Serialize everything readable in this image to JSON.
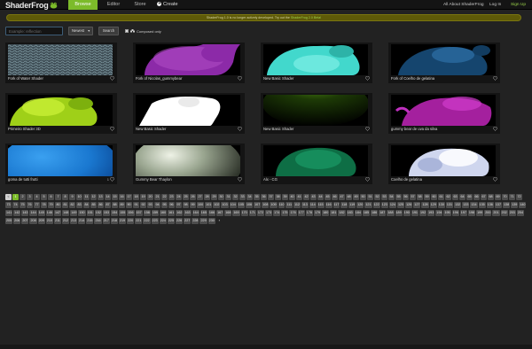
{
  "header": {
    "logo_text": "ShaderFrog",
    "tabs": [
      {
        "label": "Browse",
        "active": true
      },
      {
        "label": "Editor",
        "active": false
      },
      {
        "label": "Store",
        "active": false
      }
    ],
    "create_label": "Create",
    "create_icon": "plus-icon",
    "about_label": "All About ShaderFrog",
    "login_label": "Log In",
    "signup_label": "Sign Up",
    "accent_color": "#7cbb2a"
  },
  "banner": {
    "text": "ShaderFrog 1.0 is no longer actively developed. Try out the ",
    "link_text": "ShaderFrog 2.0 Beta!"
  },
  "search": {
    "placeholder": "Example: reflection",
    "sort_value": "Newest",
    "search_button": "Search",
    "composed_only_label": "Composed only"
  },
  "shaders": [
    {
      "title": "Fork of Water Shader",
      "likes": "",
      "thumb": "water"
    },
    {
      "title": "Fork of Nicolas_gummybear",
      "likes": "",
      "thumb": "purple-bear"
    },
    {
      "title": "New Basic Shader",
      "likes": "",
      "thumb": "cyan-bear"
    },
    {
      "title": "Fork of Coelho de gelatina",
      "likes": "",
      "thumb": "blue-bear"
    },
    {
      "title": "Primeiro Shader 3D",
      "likes": "",
      "thumb": "lime-bear"
    },
    {
      "title": "New Basic Shader",
      "likes": "",
      "thumb": "white-shape"
    },
    {
      "title": "New Basic Shader",
      "likes": "",
      "thumb": "green-sphere"
    },
    {
      "title": "gummy bear de uva da silva",
      "likes": "",
      "thumb": "magenta-bear"
    },
    {
      "title": "goma de tutti frutti",
      "likes": "1",
      "thumb": "blue-sphere"
    },
    {
      "title": "Gummy Bear Thaylon",
      "likes": "",
      "thumb": "grey-sphere"
    },
    {
      "title": "Alx - CG",
      "likes": "",
      "thumb": "teal-bear"
    },
    {
      "title": "Coelho de gelatina",
      "likes": "",
      "thumb": "white-bear"
    }
  ],
  "pagination": {
    "prev_label": "<",
    "current": "1",
    "pages": [
      "1",
      "2",
      "3",
      "4",
      "5",
      "6",
      "7",
      "8",
      "9",
      "10",
      "11",
      "12",
      "13",
      "14",
      "15",
      "16",
      "17",
      "18",
      "19",
      "20",
      "21",
      "22",
      "23",
      "24",
      "25",
      "26",
      "27",
      "28",
      "29",
      "30",
      "31",
      "32",
      "33",
      "34",
      "35",
      "36",
      "37",
      "38",
      "39",
      "40",
      "41",
      "42",
      "43",
      "44",
      "45",
      "46",
      "47",
      "48",
      "49",
      "50",
      "51",
      "52",
      "53",
      "54",
      "55",
      "56",
      "57",
      "58",
      "59",
      "60",
      "61",
      "62",
      "63",
      "64",
      "65",
      "66",
      "67",
      "68",
      "69",
      "70",
      "71",
      "72",
      "73",
      "74",
      "75",
      "76",
      "77",
      "78",
      "79",
      "80",
      "81",
      "82",
      "83",
      "84",
      "85",
      "86",
      "87",
      "88",
      "89",
      "90",
      "91",
      "92",
      "93",
      "94",
      "95",
      "96",
      "97",
      "98",
      "99",
      "100",
      "101",
      "102",
      "103",
      "104",
      "105",
      "106",
      "107",
      "108",
      "109",
      "110",
      "111",
      "112",
      "113",
      "114",
      "115",
      "116",
      "117",
      "118",
      "119",
      "120",
      "121",
      "122",
      "123",
      "124",
      "125",
      "126",
      "127",
      "128",
      "129",
      "130",
      "131",
      "132",
      "133",
      "134",
      "135",
      "136",
      "137",
      "138",
      "139",
      "140",
      "141",
      "142",
      "143",
      "144",
      "145",
      "146",
      "147",
      "148",
      "149",
      "150",
      "151",
      "152",
      "153",
      "154",
      "155",
      "156",
      "157",
      "158",
      "159",
      "160",
      "161",
      "162",
      "163",
      "164",
      "165",
      "166",
      "167",
      "168",
      "169",
      "170",
      "171",
      "172",
      "173",
      "174",
      "175",
      "176",
      "177",
      "178",
      "179",
      "180",
      "181",
      "182",
      "183",
      "184",
      "185",
      "186",
      "187",
      "188",
      "189",
      "190",
      "191",
      "192",
      "193",
      "194",
      "195",
      "196",
      "197",
      "198",
      "199",
      "200",
      "201",
      "202",
      "203",
      "204",
      "205",
      "206",
      "207",
      "208",
      "209",
      "210",
      "211",
      "212",
      "213",
      "214",
      "215",
      "216",
      "217",
      "218",
      "219",
      "220",
      "221",
      "222",
      "223",
      "224",
      "225",
      "226",
      "227",
      "228",
      "229",
      "230"
    ],
    "next_label": "›"
  }
}
